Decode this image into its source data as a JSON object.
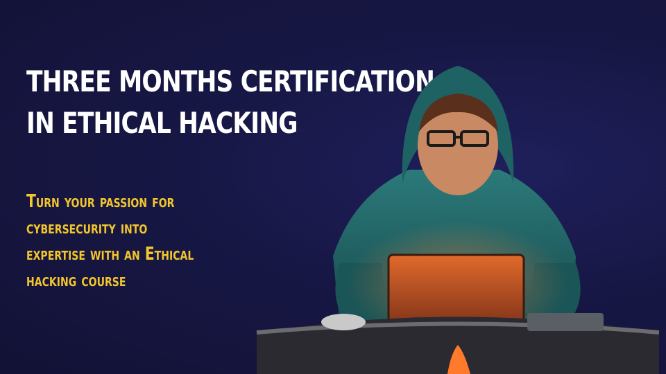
{
  "headline": {
    "line1": "THREE MONTHS CERTIFICATION",
    "line2": "IN ETHICAL HACKING"
  },
  "subhead": {
    "line1": "Turn your passion for",
    "line2": "cybersecurity into",
    "line3": "expertise with an Ethical",
    "line4": "hacking course"
  },
  "colors": {
    "background": "#171745",
    "headline": "#ffffff",
    "subhead": "#f3c62b",
    "hoodie": "#1f5f62",
    "laptop_glow": "#e0682a"
  },
  "illustration": {
    "subject": "hooded hacker at laptop"
  }
}
